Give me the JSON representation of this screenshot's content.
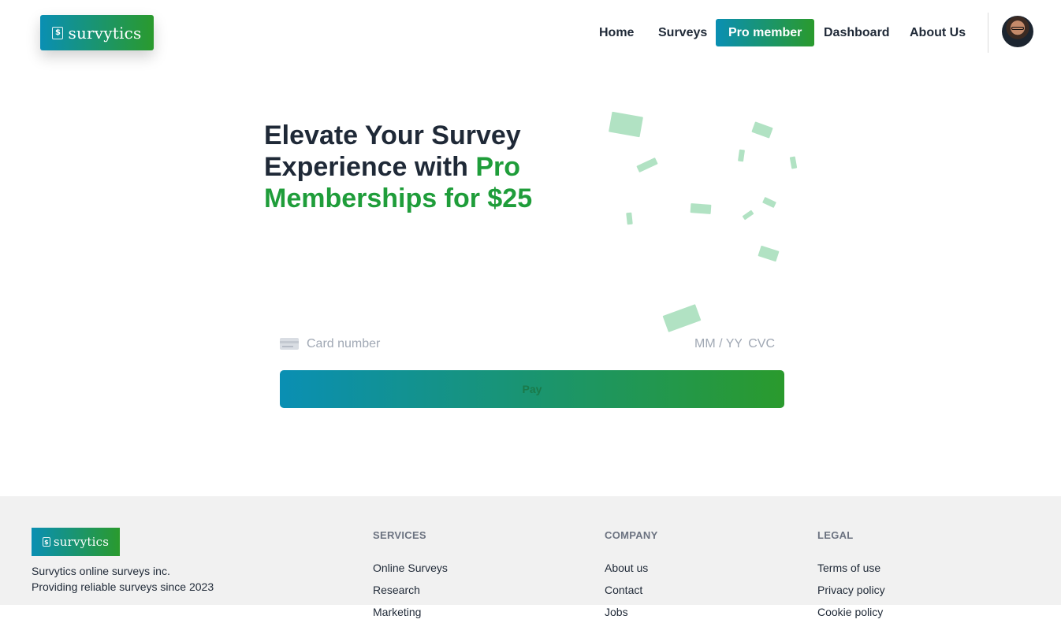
{
  "brand": {
    "name": "survytics",
    "icon": "dollar-bill-icon",
    "gradient_start": "#0a8fb3",
    "gradient_end": "#2a9a2d"
  },
  "nav": {
    "items": [
      {
        "label": "Home"
      },
      {
        "label": "Surveys"
      },
      {
        "label": "Pro member",
        "active": true
      },
      {
        "label": "Dashboard"
      },
      {
        "label": "About Us"
      }
    ],
    "avatar": "user-avatar"
  },
  "hero": {
    "line1": "Elevate Your Survey",
    "line2_plain": "Experience with ",
    "line2_accent": "Pro",
    "line3_accent": "Memberships for $25",
    "accent_color": "#1f9d3a"
  },
  "payment": {
    "card_placeholder": "Card number",
    "expiry_placeholder": "MM / YY",
    "cvc_placeholder": "CVC",
    "pay_label": "Pay"
  },
  "footer": {
    "tagline_line1": "Survytics online surveys inc.",
    "tagline_line2": "Providing reliable surveys since 2023",
    "columns": [
      {
        "heading": "SERVICES",
        "links": [
          "Online Surveys",
          "Research",
          "Marketing"
        ]
      },
      {
        "heading": "COMPANY",
        "links": [
          "About us",
          "Contact",
          "Jobs"
        ]
      },
      {
        "heading": "LEGAL",
        "links": [
          "Terms of use",
          "Privacy policy",
          "Cookie policy"
        ]
      }
    ]
  }
}
